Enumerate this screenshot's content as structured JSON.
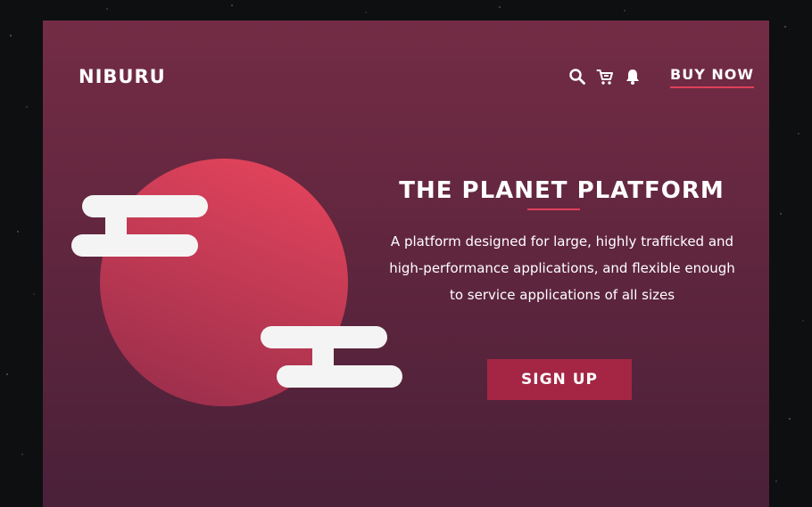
{
  "header": {
    "logo_text": "NIBURU",
    "icons": [
      "search-icon",
      "cart-icon",
      "bell-icon"
    ],
    "cta_label": "BUY NOW"
  },
  "hero": {
    "title": "THE PLANET PLATFORM",
    "description": "A platform designed for large, highly trafficked and high-performance applications, and flexible enough to service applications of all sizes",
    "button_label": "SIGN UP"
  },
  "colors": {
    "background_top": "#742c45",
    "background_bottom": "#4a2039",
    "accent": "#e0405a",
    "button": "#a42644",
    "planet_top": "#e2435b",
    "planet_bottom": "#9c2f4c",
    "cloud": "#f4f4f4"
  }
}
